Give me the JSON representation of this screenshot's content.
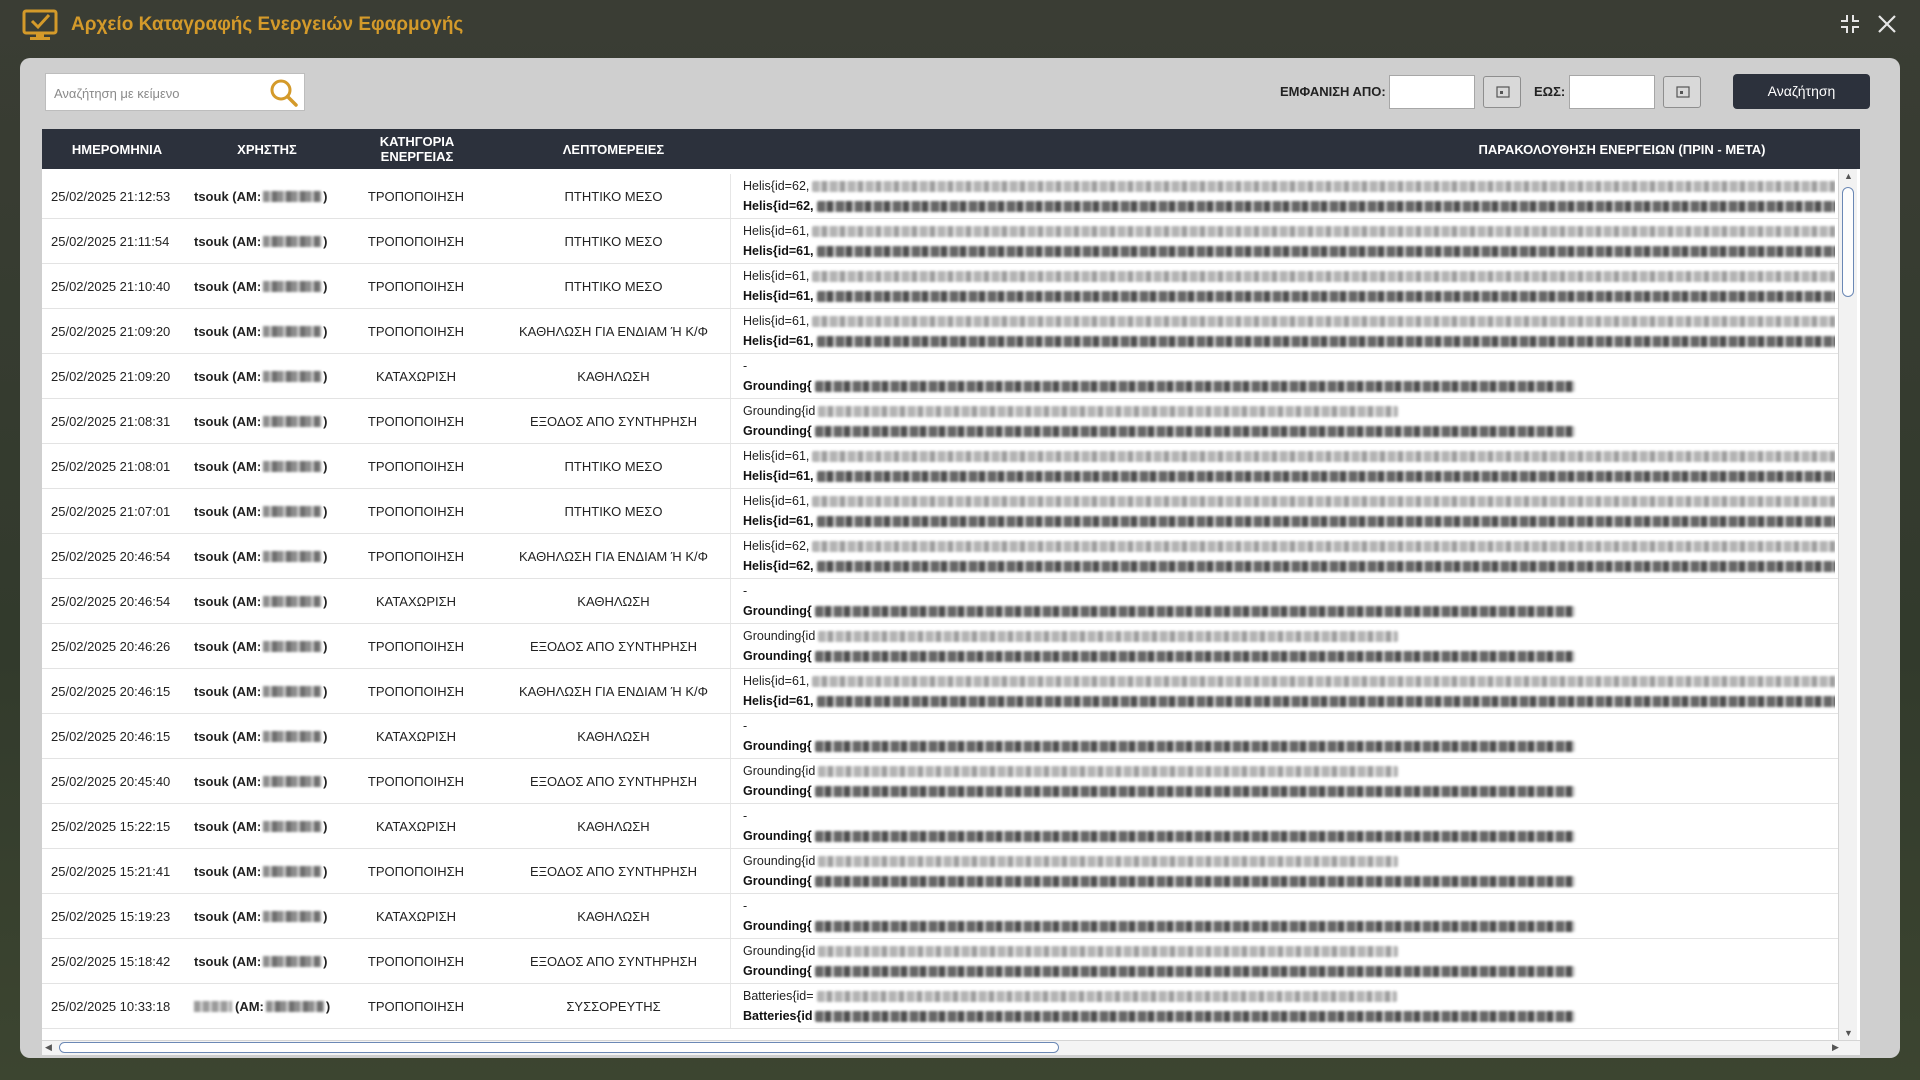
{
  "window": {
    "title": "Αρχείο Καταγραφής Ενεργειών Εφαρμογής",
    "accent_color": "#d49a2a",
    "icon": "monitor-check-icon"
  },
  "toolbar": {
    "search_placeholder": "Αναζήτηση με κείμενο",
    "from_label": "ΕΜΦΑΝΙΣΗ ΑΠΟ:",
    "to_label": "ΕΩΣ:",
    "from_value": "",
    "to_value": "",
    "search_button_label": "Αναζήτηση"
  },
  "table": {
    "headers": [
      "ΗΜΕΡΟΜΗΝΙΑ",
      "ΧΡΗΣΤΗΣ",
      "ΚΑΤΗΓΟΡΙΑ\nΕΝΕΡΓΕΙΑΣ",
      "ΛΕΠΤΟΜΕΡΕΙΕΣ",
      "ΠΑΡΑΚΟΛΟΥΘΗΣΗ ΕΝΕΡΓΕΙΩΝ (ΠΡΙΝ - ΜΕΤΑ)"
    ],
    "rows": [
      {
        "date": "25/02/2025 21:12:53",
        "user": "tsouk (AM:",
        "user_end": ")",
        "category": "ΤΡΟΠΟΠΟΙΗΣΗ",
        "details": "ΠΤΗΤΙΚΟ ΜΕΣΟ",
        "before": "Helis{id=62,",
        "after": "Helis{id=62,"
      },
      {
        "date": "25/02/2025 21:11:54",
        "user": "tsouk (AM:",
        "user_end": ")",
        "category": "ΤΡΟΠΟΠΟΙΗΣΗ",
        "details": "ΠΤΗΤΙΚΟ ΜΕΣΟ",
        "before": "Helis{id=61,",
        "after": "Helis{id=61,"
      },
      {
        "date": "25/02/2025 21:10:40",
        "user": "tsouk (AM:",
        "user_end": ")",
        "category": "ΤΡΟΠΟΠΟΙΗΣΗ",
        "details": "ΠΤΗΤΙΚΟ ΜΕΣΟ",
        "before": "Helis{id=61,",
        "after": "Helis{id=61,"
      },
      {
        "date": "25/02/2025 21:09:20",
        "user": "tsouk (AM:",
        "user_end": ")",
        "category": "ΤΡΟΠΟΠΟΙΗΣΗ",
        "details": "ΚΑΘΗΛΩΣΗ ΓΙΑ ΕΝΔΙΑΜ Ή Κ/Φ",
        "before": "Helis{id=61,",
        "after": "Helis{id=61,"
      },
      {
        "date": "25/02/2025 21:09:20",
        "user": "tsouk (AM:",
        "user_end": ")",
        "category": "ΚΑΤΑΧΩΡΙΣΗ",
        "details": "ΚΑΘΗΛΩΣΗ",
        "before": "-",
        "after": "Grounding{"
      },
      {
        "date": "25/02/2025 21:08:31",
        "user": "tsouk (AM:",
        "user_end": ")",
        "category": "ΤΡΟΠΟΠΟΙΗΣΗ",
        "details": "ΕΞΟΔΟΣ ΑΠΟ ΣΥΝΤΗΡΗΣΗ",
        "before": "Grounding{id",
        "after": "Grounding{"
      },
      {
        "date": "25/02/2025 21:08:01",
        "user": "tsouk (AM:",
        "user_end": ")",
        "category": "ΤΡΟΠΟΠΟΙΗΣΗ",
        "details": "ΠΤΗΤΙΚΟ ΜΕΣΟ",
        "before": "Helis{id=61,",
        "after": "Helis{id=61,"
      },
      {
        "date": "25/02/2025 21:07:01",
        "user": "tsouk (AM:",
        "user_end": ")",
        "category": "ΤΡΟΠΟΠΟΙΗΣΗ",
        "details": "ΠΤΗΤΙΚΟ ΜΕΣΟ",
        "before": "Helis{id=61,",
        "after": "Helis{id=61,"
      },
      {
        "date": "25/02/2025 20:46:54",
        "user": "tsouk (AM:",
        "user_end": ")",
        "category": "ΤΡΟΠΟΠΟΙΗΣΗ",
        "details": "ΚΑΘΗΛΩΣΗ ΓΙΑ ΕΝΔΙΑΜ Ή Κ/Φ",
        "before": "Helis{id=62,",
        "after": "Helis{id=62,"
      },
      {
        "date": "25/02/2025 20:46:54",
        "user": "tsouk (AM:",
        "user_end": ")",
        "category": "ΚΑΤΑΧΩΡΙΣΗ",
        "details": "ΚΑΘΗΛΩΣΗ",
        "before": "-",
        "after": "Grounding{"
      },
      {
        "date": "25/02/2025 20:46:26",
        "user": "tsouk (AM:",
        "user_end": ")",
        "category": "ΤΡΟΠΟΠΟΙΗΣΗ",
        "details": "ΕΞΟΔΟΣ ΑΠΟ ΣΥΝΤΗΡΗΣΗ",
        "before": "Grounding{id",
        "after": "Grounding{"
      },
      {
        "date": "25/02/2025 20:46:15",
        "user": "tsouk (AM:",
        "user_end": ")",
        "category": "ΤΡΟΠΟΠΟΙΗΣΗ",
        "details": "ΚΑΘΗΛΩΣΗ ΓΙΑ ΕΝΔΙΑΜ Ή Κ/Φ",
        "before": "Helis{id=61,",
        "after": "Helis{id=61,"
      },
      {
        "date": "25/02/2025 20:46:15",
        "user": "tsouk (AM:",
        "user_end": ")",
        "category": "ΚΑΤΑΧΩΡΙΣΗ",
        "details": "ΚΑΘΗΛΩΣΗ",
        "before": "-",
        "after": "Grounding{"
      },
      {
        "date": "25/02/2025 20:45:40",
        "user": "tsouk (AM:",
        "user_end": ")",
        "category": "ΤΡΟΠΟΠΟΙΗΣΗ",
        "details": "ΕΞΟΔΟΣ ΑΠΟ ΣΥΝΤΗΡΗΣΗ",
        "before": "Grounding{id",
        "after": "Grounding{"
      },
      {
        "date": "25/02/2025 15:22:15",
        "user": "tsouk (AM:",
        "user_end": ")",
        "category": "ΚΑΤΑΧΩΡΙΣΗ",
        "details": "ΚΑΘΗΛΩΣΗ",
        "before": "-",
        "after": "Grounding{"
      },
      {
        "date": "25/02/2025 15:21:41",
        "user": "tsouk (AM:",
        "user_end": ")",
        "category": "ΤΡΟΠΟΠΟΙΗΣΗ",
        "details": "ΕΞΟΔΟΣ ΑΠΟ ΣΥΝΤΗΡΗΣΗ",
        "before": "Grounding{id",
        "after": "Grounding{"
      },
      {
        "date": "25/02/2025 15:19:23",
        "user": "tsouk (AM:",
        "user_end": ")",
        "category": "ΚΑΤΑΧΩΡΙΣΗ",
        "details": "ΚΑΘΗΛΩΣΗ",
        "before": "-",
        "after": "Grounding{"
      },
      {
        "date": "25/02/2025 15:18:42",
        "user": "tsouk (AM:",
        "user_end": ")",
        "category": "ΤΡΟΠΟΠΟΙΗΣΗ",
        "details": "ΕΞΟΔΟΣ ΑΠΟ ΣΥΝΤΗΡΗΣΗ",
        "before": "Grounding{id",
        "after": "Grounding{"
      },
      {
        "date": "25/02/2025 10:33:18",
        "user": "(AM:",
        "user_end": ")",
        "category": "ΤΡΟΠΟΠΟΙΗΣΗ",
        "details": "ΣΥΣΣΟΡΕΥΤΗΣ",
        "before": "Batteries{id=",
        "after": "Batteries{id"
      }
    ]
  }
}
